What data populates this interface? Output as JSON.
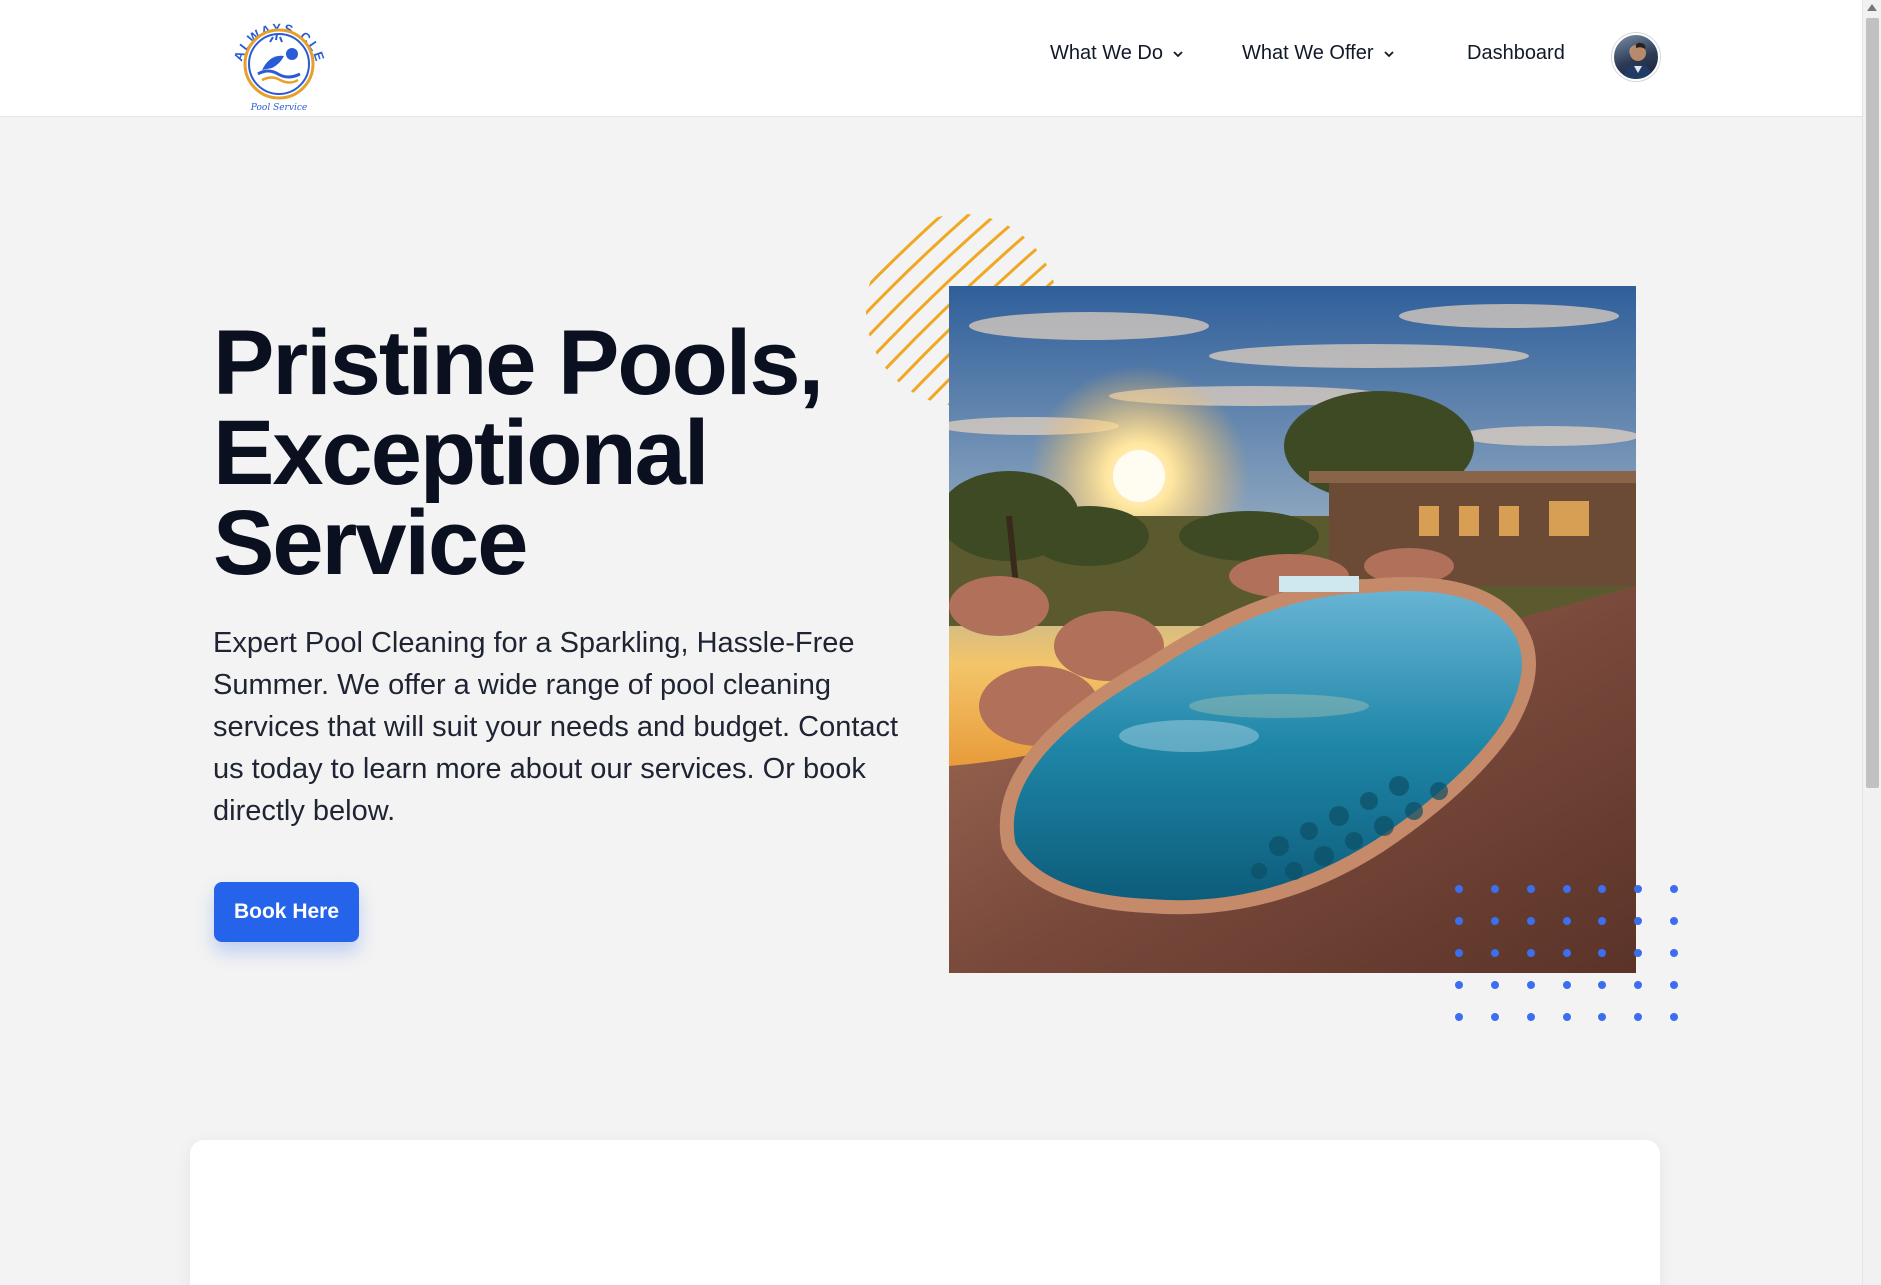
{
  "header": {
    "logo": {
      "arc_text": "ALWAYS CLEAN",
      "sub_text": "Pool Service",
      "icon": "swimmer-icon"
    },
    "nav": [
      {
        "label": "What We Do",
        "has_dropdown": true
      },
      {
        "label": "What We Offer",
        "has_dropdown": true
      },
      {
        "label": "Dashboard",
        "has_dropdown": false
      }
    ],
    "avatar": "user-avatar"
  },
  "hero": {
    "title_lines": [
      "Pristine Pools,",
      "Exceptional",
      "Service"
    ],
    "description": "Expert Pool Cleaning for a Sparkling, Hassle-Free Summer. We offer a wide range of pool cleaning services that will suit your needs and budget. Contact us today to learn more about our services. Or book directly below.",
    "cta_label": "Book Here",
    "image": "desert-pool-at-sunset"
  },
  "colors": {
    "accent": "#2563eb",
    "stripe": "#f0a824",
    "text": "#0b1020",
    "background": "#f3f3f3"
  }
}
